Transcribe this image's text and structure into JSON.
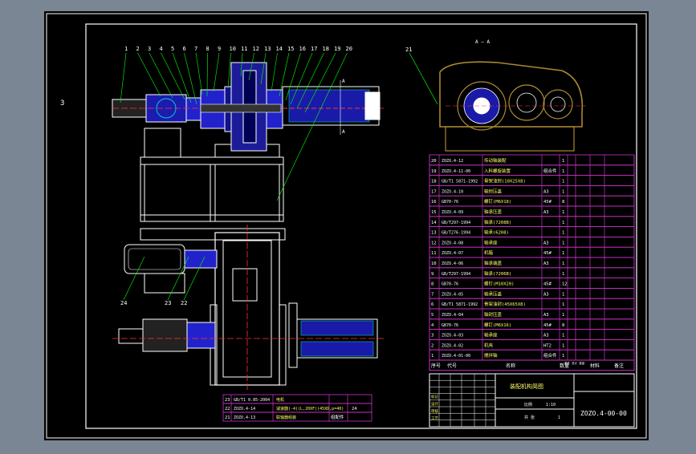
{
  "colors": {
    "background": "#000000",
    "frame": "#ffffff",
    "table": "#cc33cc",
    "text_yellow": "#ffff66",
    "text_white": "#ffffff",
    "leader": "#00ff00",
    "metal_blue": "#2222cc",
    "cyan": "#00cccc",
    "gold": "#aa8833"
  },
  "sheet": {
    "side_mark": "3",
    "view_label": "A — A",
    "drawing_no": "ZOZO.4-00-00",
    "title": "装配机构简图"
  },
  "balloons": [
    "1",
    "2",
    "3",
    "4",
    "5",
    "6",
    "7",
    "8",
    "9",
    "10",
    "11",
    "12",
    "13",
    "14",
    "15",
    "16",
    "17",
    "18",
    "19",
    "20"
  ],
  "balloons_lower": [
    "24",
    "23",
    "22"
  ],
  "balloon_side": "21",
  "bom_rows": [
    {
      "no": "20",
      "code": "ZOZO.4-12",
      "name": "传动轴装配",
      "qty": "1"
    },
    {
      "no": "19",
      "code": "ZOZO.4-11-00",
      "name": "入料螺旋装置",
      "mat": "组合件",
      "qty": "1"
    },
    {
      "no": "18",
      "code": "GB/T1 5871-1992",
      "name": "骨架油封(10X25X8)",
      "qty": "1"
    },
    {
      "no": "17",
      "code": "ZOZO.4-10",
      "name": "轴封压盖",
      "mat": "A3",
      "qty": "1"
    },
    {
      "no": "16",
      "code": "GB70-76",
      "name": "螺钉(M6X18)",
      "mat": "45#",
      "qty": "8"
    },
    {
      "no": "15",
      "code": "ZOZO.4-09",
      "name": "轴承压盖",
      "mat": "A3",
      "qty": "1"
    },
    {
      "no": "14",
      "code": "GB/T297-1994",
      "name": "轴承(7208B)",
      "qty": "1"
    },
    {
      "no": "13",
      "code": "GB/T276-1994",
      "name": "轴承(6208)",
      "qty": "1"
    },
    {
      "no": "12",
      "code": "ZOZO.4-08",
      "name": "轴承座",
      "mat": "A3",
      "qty": "1"
    },
    {
      "no": "11",
      "code": "ZOZO.4-07",
      "name": "机箱",
      "mat": "45#",
      "qty": "1"
    },
    {
      "no": "10",
      "code": "ZOZO.4-06",
      "name": "轴承端盖",
      "mat": "A3",
      "qty": "1"
    },
    {
      "no": "9",
      "code": "GB/T297-1994",
      "name": "轴承(7206B)",
      "qty": "1"
    },
    {
      "no": "8",
      "code": "GB70-76",
      "name": "螺钉(M10X20)",
      "mat": "45#",
      "qty": "12"
    },
    {
      "no": "7",
      "code": "ZOZO.4-05",
      "name": "轴承压盖",
      "mat": "A3",
      "qty": "1"
    },
    {
      "no": "6",
      "code": "GB/T1 5871-1992",
      "name": "骨架油封(45X65X8)",
      "qty": "1"
    },
    {
      "no": "5",
      "code": "ZOZO.4-04",
      "name": "轴封压盖",
      "mat": "A3",
      "qty": "1"
    },
    {
      "no": "4",
      "code": "GB70-76",
      "name": "螺钉(M6X16)",
      "mat": "45#",
      "qty": "8"
    },
    {
      "no": "3",
      "code": "ZOZO.4-03",
      "name": "轴承座",
      "mat": "A3",
      "qty": "1"
    },
    {
      "no": "2",
      "code": "ZOZO.4-02",
      "name": "机壳",
      "mat": "HT2",
      "qty": "1"
    },
    {
      "no": "1",
      "code": "ZOZO.4-01-00",
      "name": "搅拌轴",
      "mat": "组合件",
      "qty": "1"
    }
  ],
  "bom_header": [
    "序号",
    "代号",
    "名称",
    "数量",
    "材料",
    "备注"
  ],
  "bom_header_note": "单件 总计 重量",
  "lower_table": [
    {
      "no": "23",
      "code": "GB/T1 0.85-2004",
      "name": "电机"
    },
    {
      "no": "22",
      "code": "ZOZO.4-14",
      "name": "减速器(-4)(L,20XF)(45XD,p=40)",
      "qty": "24"
    },
    {
      "no": "21",
      "code": "ZOZO.4-13",
      "name": "联轴器组装",
      "mat": "组配件"
    }
  ],
  "title_block": {
    "rows": [
      "标记",
      "设计",
      "审核",
      "工艺"
    ],
    "scale_label": "比例",
    "sheet_label": "共 张",
    "mark1": "1:10",
    "mark2": "1"
  }
}
